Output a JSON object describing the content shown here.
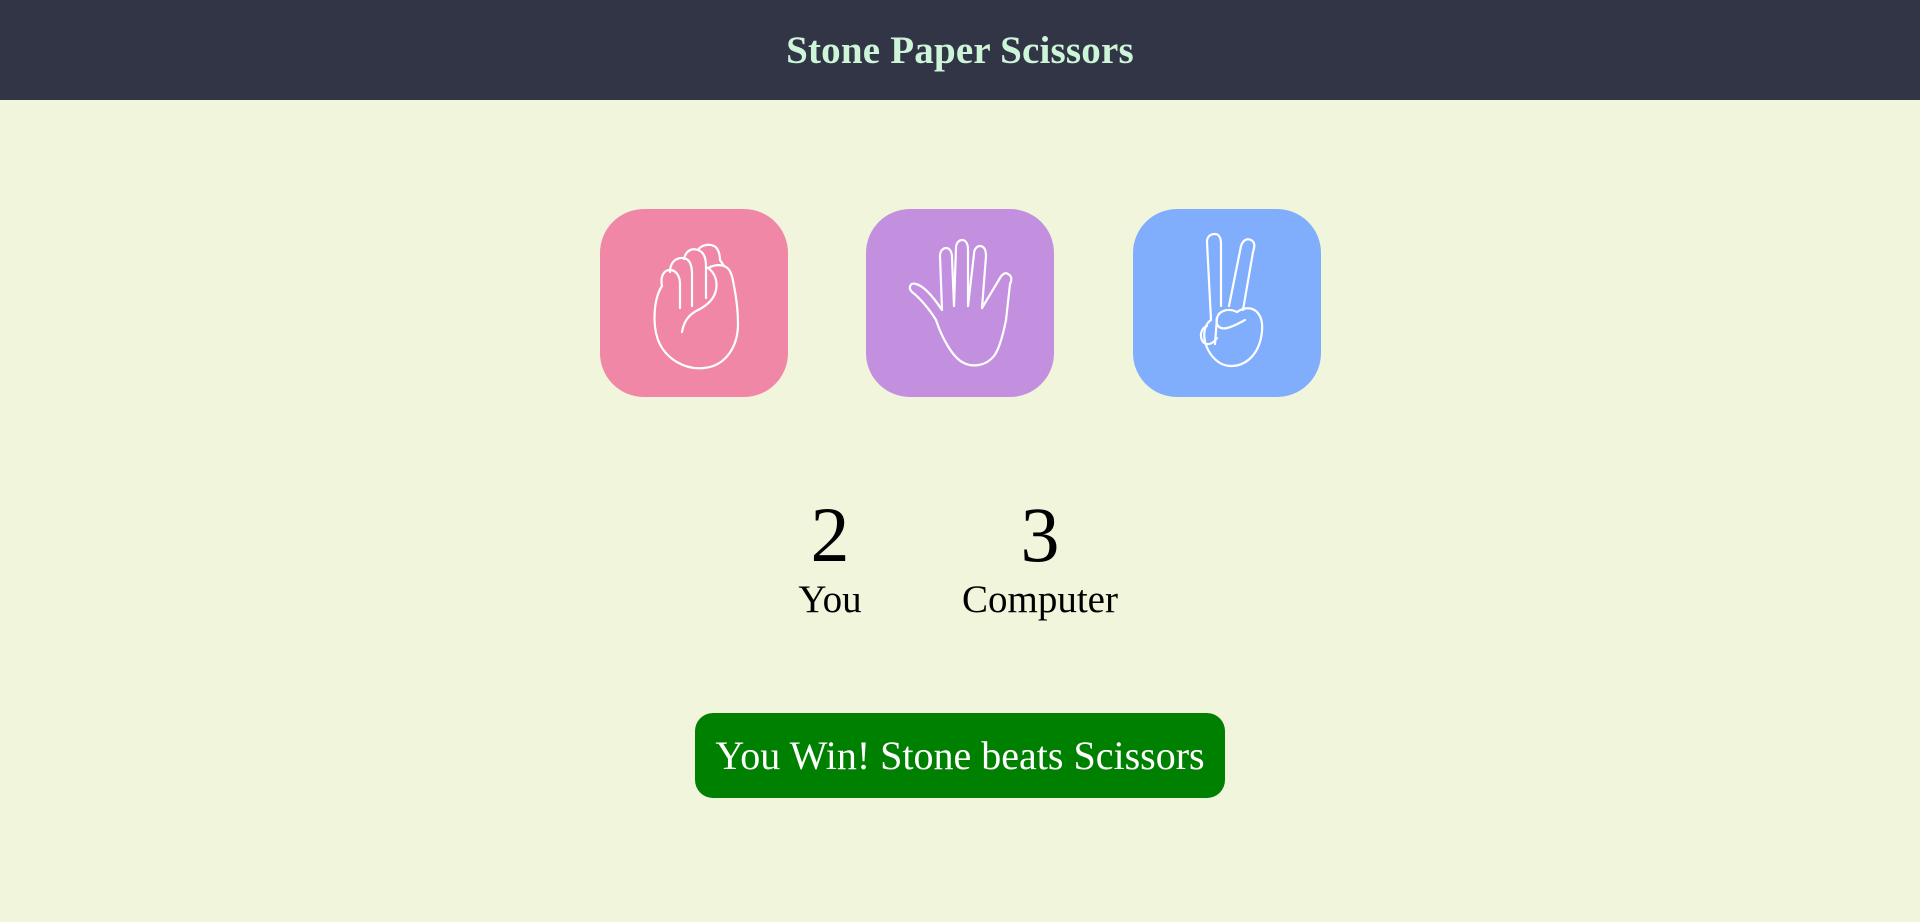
{
  "header": {
    "title": "Stone Paper Scissors",
    "background_color": "#323546",
    "title_color": "#cdf5d8"
  },
  "choices": [
    {
      "id": "stone",
      "icon": "fist-icon",
      "color": "#f087a6"
    },
    {
      "id": "paper",
      "icon": "open-hand-icon",
      "color": "#c38fdf"
    },
    {
      "id": "scissors",
      "icon": "victory-hand-icon",
      "color": "#80aefd"
    }
  ],
  "scores": {
    "user": {
      "value": "2",
      "label": "You"
    },
    "computer": {
      "value": "3",
      "label": "Computer"
    }
  },
  "result": {
    "message": "You Win! Stone beats Scissors",
    "color": "#008000"
  },
  "page_background": "#f0f5dc"
}
